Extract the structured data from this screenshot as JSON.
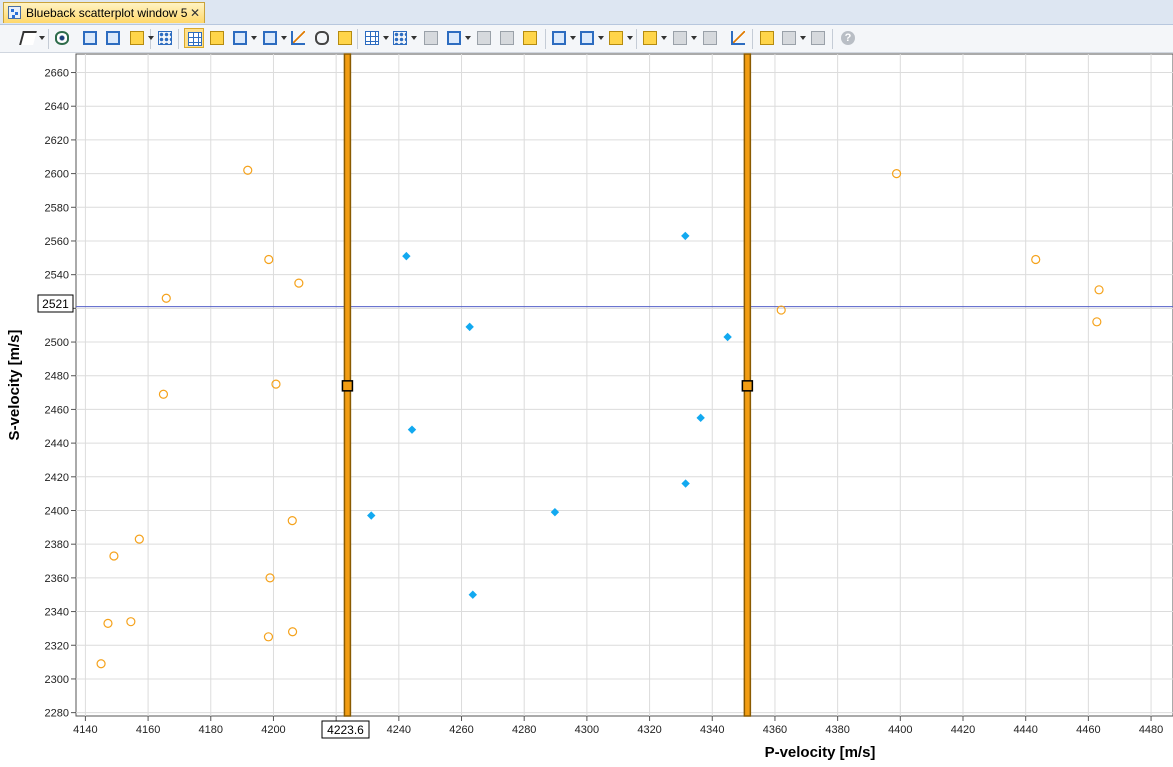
{
  "window": {
    "tab_title": "Blueback scatterplot window 5",
    "tab_close_glyph": "✕"
  },
  "toolbar": {
    "items": [
      {
        "icon": "select-pointer-icon",
        "dropdown": true
      },
      {
        "icon": "view-eye-icon"
      },
      {
        "icon": "zoom-in-icon"
      },
      {
        "icon": "zoom-out-icon"
      },
      {
        "icon": "color-fill-icon",
        "dropdown": true
      },
      {
        "icon": "node-network-icon"
      },
      {
        "icon": "crosshair-grid-icon",
        "active": true
      },
      {
        "icon": "table-icon"
      },
      {
        "icon": "frame-icon",
        "dropdown": true
      },
      {
        "icon": "rectangle-icon",
        "dropdown": true
      },
      {
        "icon": "reset-axes-icon"
      },
      {
        "icon": "link-icon"
      },
      {
        "icon": "pen-edit-icon"
      },
      {
        "icon": "grid-select-icon",
        "dropdown": true
      },
      {
        "icon": "dots-select-icon",
        "dropdown": true
      },
      {
        "icon": "gray-bar-icon"
      },
      {
        "icon": "lasso-icon",
        "dropdown": true
      },
      {
        "icon": "gray-filter-icon"
      },
      {
        "icon": "gray-bar-icon-2"
      },
      {
        "icon": "pen-edit-icon-2"
      },
      {
        "icon": "window-add-icon",
        "dropdown": true
      },
      {
        "icon": "window-split-icon",
        "dropdown": true
      },
      {
        "icon": "window-color-icon",
        "dropdown": true
      },
      {
        "icon": "sparkle-grid-icon",
        "dropdown": true
      },
      {
        "icon": "curve-icon",
        "dropdown": true
      },
      {
        "icon": "filter-list-icon"
      },
      {
        "icon": "regression-line-icon"
      },
      {
        "icon": "new-window-icon"
      },
      {
        "icon": "stack-icon",
        "dropdown": true
      },
      {
        "icon": "export-icon"
      },
      {
        "icon": "help-icon"
      }
    ]
  },
  "chart_data": {
    "type": "scatter",
    "xlabel": "P-velocity [m/s]",
    "ylabel": "S-velocity [m/s]",
    "xlim": [
      4137,
      4487
    ],
    "ylim": [
      2278,
      2671
    ],
    "xticks": [
      4140,
      4160,
      4180,
      4200,
      4220,
      4240,
      4260,
      4280,
      4300,
      4320,
      4340,
      4360,
      4380,
      4400,
      4420,
      4440,
      4460,
      4480
    ],
    "yticks": [
      2280,
      2300,
      2320,
      2340,
      2360,
      2380,
      2400,
      2420,
      2440,
      2460,
      2480,
      2500,
      2520,
      2540,
      2560,
      2580,
      2600,
      2620,
      2640,
      2660
    ],
    "grid": true,
    "colors": {
      "outside": "#f5a21b",
      "inside": "#12a9f0",
      "cutoff_line": "#8a5a00",
      "cutoff_fill": "#f29d13",
      "crosshair": "#5560c8"
    },
    "series": [
      {
        "marker": "open-circle",
        "points": [
          [
            4191.8,
            2602
          ],
          [
            4198.5,
            2549
          ],
          [
            4208.1,
            2535
          ],
          [
            4165.8,
            2526
          ],
          [
            4200.8,
            2475
          ],
          [
            4164.9,
            2469
          ],
          [
            4206.0,
            2394
          ],
          [
            4157.2,
            2383
          ],
          [
            4149.1,
            2373
          ],
          [
            4198.9,
            2360
          ],
          [
            4154.5,
            2334
          ],
          [
            4147.2,
            2333
          ],
          [
            4206.1,
            2328
          ],
          [
            4198.4,
            2325
          ],
          [
            4145.0,
            2309
          ],
          [
            4398.8,
            2600
          ],
          [
            4443.2,
            2549
          ],
          [
            4463.4,
            2531
          ],
          [
            4362.0,
            2519
          ],
          [
            4462.7,
            2512
          ]
        ]
      },
      {
        "marker": "filled-diamond",
        "points": [
          [
            4242.4,
            2551
          ],
          [
            4262.6,
            2509
          ],
          [
            4244.2,
            2448
          ],
          [
            4231.2,
            2397
          ],
          [
            4263.6,
            2350
          ],
          [
            4289.8,
            2399
          ],
          [
            4331.4,
            2563
          ],
          [
            4344.9,
            2503
          ],
          [
            4336.3,
            2455
          ],
          [
            4331.5,
            2416
          ]
        ]
      }
    ],
    "cutoffs": {
      "x": [
        4223.6,
        4351.2
      ],
      "handle_y": 2474
    },
    "crosshair": {
      "x": 4223.6,
      "y": 2521
    }
  },
  "readouts": {
    "x_value": "4223.6",
    "y_value": "2521"
  }
}
